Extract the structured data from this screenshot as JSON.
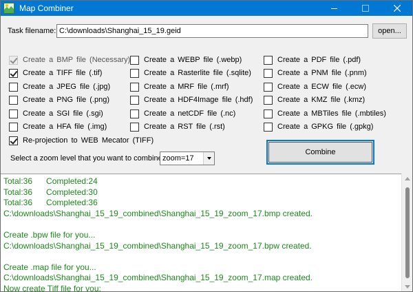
{
  "window": {
    "title": "Map Combiner",
    "accent_color": "#0078d4",
    "icon": "map-app-icon"
  },
  "task": {
    "label": "Task filename:",
    "value": "C:\\downloads\\Shanghai_15_19.geid",
    "open_label": "open..."
  },
  "formats": {
    "col1": [
      {
        "text": "Create a  BMP file (Necessary)",
        "checked": true,
        "disabled": true
      },
      {
        "text": "Create a  TIFF file  (.tif)",
        "checked": true,
        "disabled": false
      },
      {
        "text": "Create a  JPEG file  (.jpg)",
        "checked": false,
        "disabled": false
      },
      {
        "text": "Create a  PNG file  (.png)",
        "checked": false,
        "disabled": false
      },
      {
        "text": "Create a  SGI file  (.sgi)",
        "checked": false,
        "disabled": false
      },
      {
        "text": "Create a  HFA file  (.img)",
        "checked": false,
        "disabled": false
      }
    ],
    "col2": [
      {
        "text": "Create a  WEBP file  (.webp)",
        "checked": false,
        "disabled": false
      },
      {
        "text": "Create a  Rasterlite file  (.sqlite)",
        "checked": false,
        "disabled": false
      },
      {
        "text": "Create a  MRF file  (.mrf)",
        "checked": false,
        "disabled": false
      },
      {
        "text": "Create a  HDF4Image file  (.hdf)",
        "checked": false,
        "disabled": false
      },
      {
        "text": "Create a  netCDF file  (.nc)",
        "checked": false,
        "disabled": false
      },
      {
        "text": "Create a  RST file  (.rst)",
        "checked": false,
        "disabled": false
      }
    ],
    "col3": [
      {
        "text": "Create a  PDF file  (.pdf)",
        "checked": false,
        "disabled": false
      },
      {
        "text": "Create a  PNM file  (.pnm)",
        "checked": false,
        "disabled": false
      },
      {
        "text": "Create a  ECW file  (.ecw)",
        "checked": false,
        "disabled": false
      },
      {
        "text": "Create a  KMZ file  (.kmz)",
        "checked": false,
        "disabled": false
      },
      {
        "text": "Create a  MBTiles file  (.mbtiles)",
        "checked": false,
        "disabled": false
      },
      {
        "text": "Create a  GPKG file  (.gpkg)",
        "checked": false,
        "disabled": false
      }
    ]
  },
  "reprojection": {
    "text": "Re-projection to WEB Mecator  (TIFF)",
    "checked": true
  },
  "zoom": {
    "label": "Select a zoom level that you want to combine:",
    "value": "zoom=17"
  },
  "combine_label": "Combine",
  "log": {
    "color": "#1a8a1a",
    "lines": [
      "Total:36      Completed:24",
      "Total:36      Completed:30",
      "Total:36      Completed:36",
      "C:\\downloads\\Shanghai_15_19_combined\\Shanghai_15_19_zoom_17.bmp created.",
      "",
      "Create .bpw file for you...",
      "C:\\downloads\\Shanghai_15_19_combined\\Shanghai_15_19_zoom_17.bpw created.",
      "",
      "Create .map file for you...",
      "C:\\downloads\\Shanghai_15_19_combined\\Shanghai_15_19_zoom_17.map created.",
      "Now create Tiff file for you:"
    ]
  }
}
